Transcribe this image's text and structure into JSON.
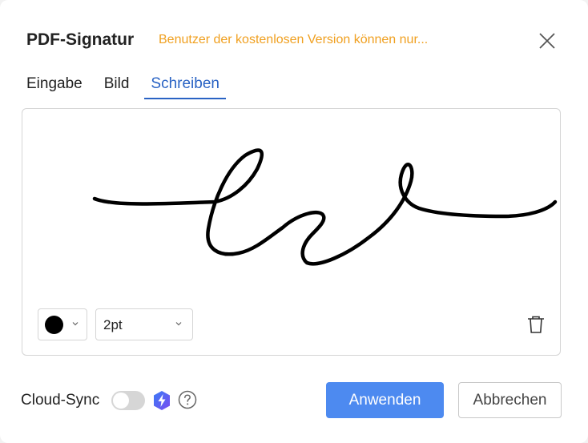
{
  "dialog": {
    "title": "PDF-Signatur",
    "notice": "Benutzer der kostenlosen Version können nur...",
    "close_icon": "close-icon"
  },
  "tabs": [
    {
      "label": "Eingabe",
      "active": false
    },
    {
      "label": "Bild",
      "active": false
    },
    {
      "label": "Schreiben",
      "active": true
    }
  ],
  "canvas": {
    "pen_color": "#000000",
    "pen_size": "2pt",
    "has_signature": true,
    "delete_icon": "trash-icon"
  },
  "footer": {
    "cloud_sync_label": "Cloud-Sync",
    "cloud_sync_enabled": false,
    "premium_icon": "bolt-badge-icon",
    "help_icon": "help-circle-icon",
    "apply_label": "Anwenden",
    "cancel_label": "Abbrechen"
  },
  "colors": {
    "accent": "#2a63c4",
    "primary_button": "#4d8af0",
    "notice": "#f0a020"
  }
}
